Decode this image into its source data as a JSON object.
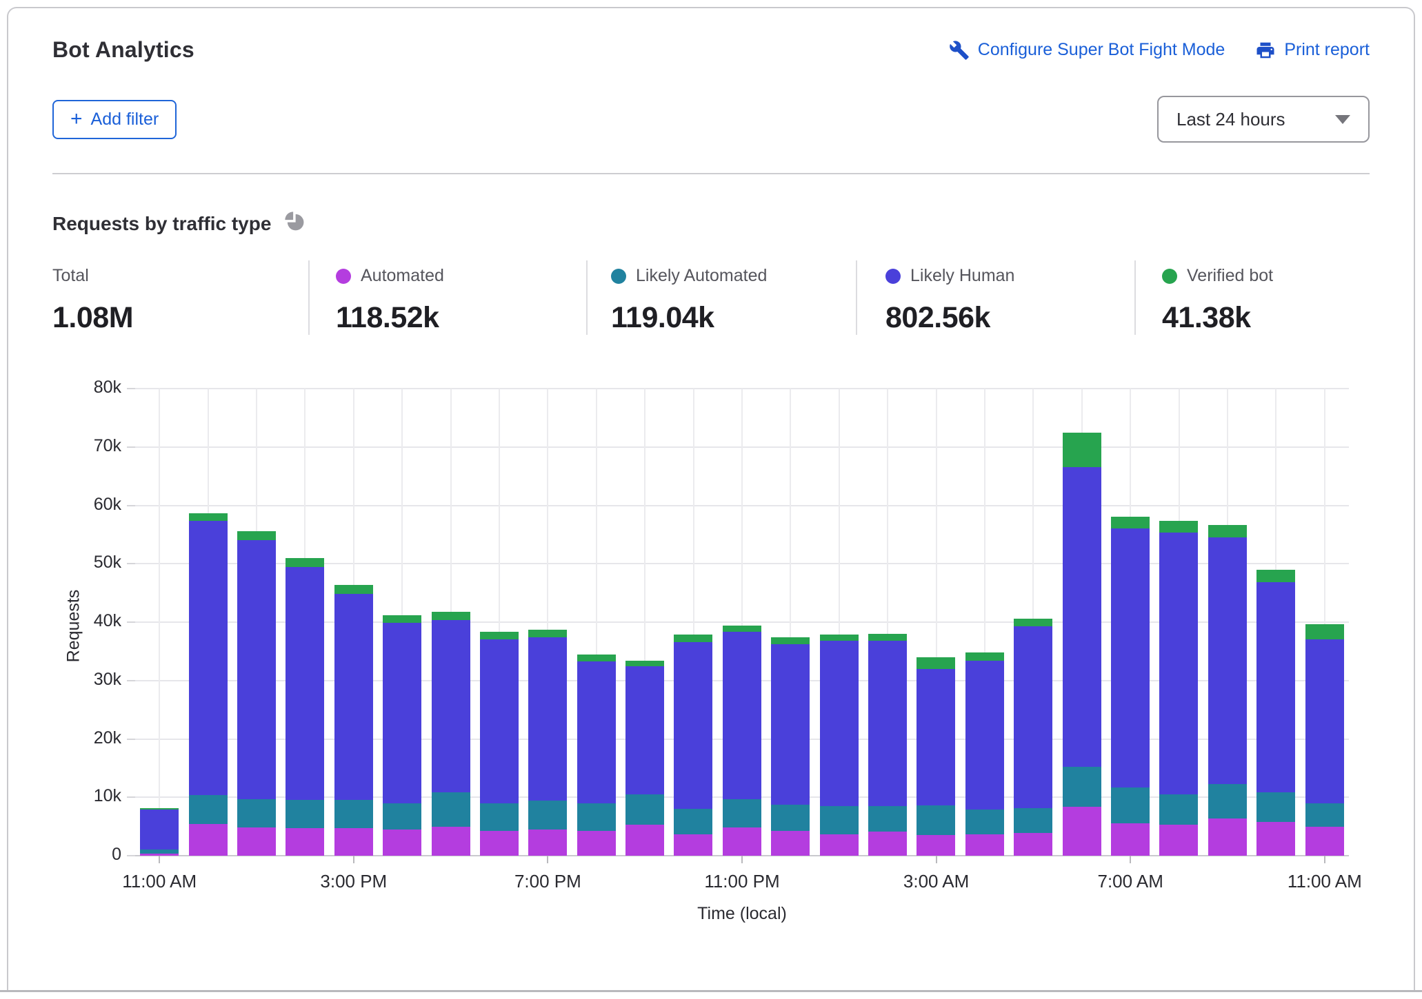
{
  "header": {
    "title": "Bot Analytics",
    "configure_link": "Configure Super Bot Fight Mode",
    "print_link": "Print report",
    "add_filter": "Add filter",
    "add_filter_plus": "+",
    "time_range": "Last 24 hours"
  },
  "section": {
    "title": "Requests by traffic type"
  },
  "stats": [
    {
      "label": "Total",
      "value": "1.08M",
      "color": ""
    },
    {
      "label": "Automated",
      "value": "118.52k",
      "color": "#b43ddf"
    },
    {
      "label": "Likely Automated",
      "value": "119.04k",
      "color": "#20829f"
    },
    {
      "label": "Likely Human",
      "value": "802.56k",
      "color": "#4a40da"
    },
    {
      "label": "Verified bot",
      "value": "41.38k",
      "color": "#27a44f"
    }
  ],
  "chart_data": {
    "type": "bar",
    "stacked": true,
    "title": "Requests by traffic type",
    "xlabel": "Time (local)",
    "ylabel": "Requests",
    "ylim": [
      0,
      80000
    ],
    "ytick_step": 10000,
    "ytick_labels": [
      "0",
      "10k",
      "20k",
      "30k",
      "40k",
      "50k",
      "60k",
      "70k",
      "80k"
    ],
    "xtick_labels": [
      "11:00 AM",
      "3:00 PM",
      "7:00 PM",
      "11:00 PM",
      "3:00 AM",
      "7:00 AM",
      "11:00 AM"
    ],
    "xtick_indices": [
      0,
      4,
      8,
      12,
      16,
      20,
      24
    ],
    "grid": true,
    "categories": [
      "11:00 AM",
      "12:00 PM",
      "1:00 PM",
      "2:00 PM",
      "3:00 PM",
      "4:00 PM",
      "5:00 PM",
      "6:00 PM",
      "7:00 PM",
      "8:00 PM",
      "9:00 PM",
      "10:00 PM",
      "11:00 PM",
      "12:00 AM",
      "1:00 AM",
      "2:00 AM",
      "3:00 AM",
      "4:00 AM",
      "5:00 AM",
      "6:00 AM",
      "7:00 AM",
      "8:00 AM",
      "9:00 AM",
      "10:00 AM",
      "11:00 AM"
    ],
    "series": [
      {
        "name": "Automated",
        "color": "#b43ddf",
        "values": [
          400,
          5400,
          4800,
          4700,
          4700,
          4500,
          4900,
          4300,
          4500,
          4200,
          5300,
          3700,
          4800,
          4200,
          3700,
          4100,
          3600,
          3700,
          3900,
          8400,
          5500,
          5300,
          6400,
          5800,
          5000
        ]
      },
      {
        "name": "Likely Automated",
        "color": "#20829f",
        "values": [
          700,
          5000,
          4900,
          4900,
          4900,
          4500,
          5900,
          4700,
          4900,
          4800,
          5200,
          4300,
          4900,
          4500,
          4800,
          4400,
          5000,
          4200,
          4300,
          6800,
          6200,
          5200,
          5900,
          5000,
          4000
        ]
      },
      {
        "name": "Likely Human",
        "color": "#4a40da",
        "values": [
          6800,
          46900,
          44400,
          39800,
          35300,
          30900,
          29500,
          28100,
          28000,
          24300,
          22000,
          28600,
          28600,
          27500,
          28300,
          28300,
          23400,
          25500,
          31100,
          51300,
          44400,
          44800,
          42200,
          36000,
          28000
        ]
      },
      {
        "name": "Verified bot",
        "color": "#27a44f",
        "values": [
          300,
          1300,
          1500,
          1600,
          1500,
          1300,
          1500,
          1300,
          1300,
          1200,
          900,
          1300,
          1100,
          1200,
          1100,
          1200,
          2000,
          1400,
          1300,
          5900,
          1900,
          2100,
          2100,
          2200,
          2600
        ]
      }
    ]
  }
}
